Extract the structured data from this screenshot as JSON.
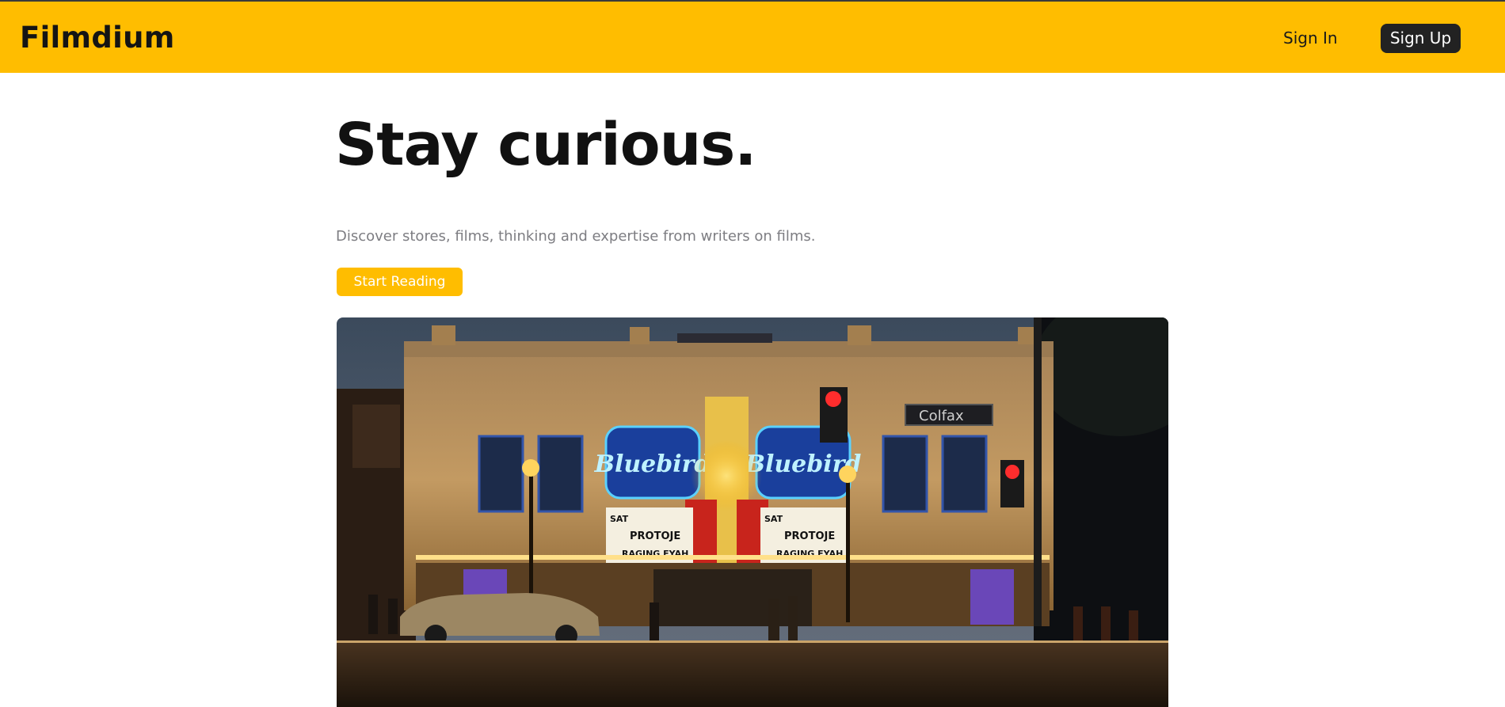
{
  "header": {
    "brand": "Filmdium",
    "sign_in_label": "Sign In",
    "sign_up_label": "Sign Up"
  },
  "hero": {
    "title": "Stay curious.",
    "subtitle": "Discover stores, films, thinking and expertise from writers on films.",
    "cta_label": "Start Reading"
  },
  "image": {
    "alt": "theater-marquee-photo",
    "marquee_sign_left": "Bluebird",
    "marquee_sign_right": "Bluebird",
    "marquee_lines_left": [
      "SAT",
      "PROTOJE",
      "RAGING FYAH"
    ],
    "marquee_lines_right": [
      "SAT",
      "PROTOJE",
      "RAGING FYAH"
    ],
    "street_sign": "Colfax"
  },
  "colors": {
    "accent": "#ffbd00",
    "dark_button": "#222222",
    "subtitle_gray": "#7d7d82"
  }
}
